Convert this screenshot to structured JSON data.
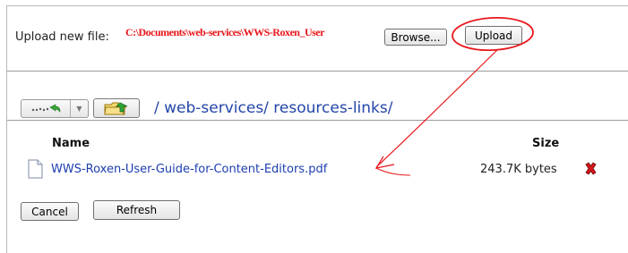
{
  "upload": {
    "label": "Upload new file:",
    "file_path_value": "C:\\Documents\\web-services\\WWS-Roxen_User",
    "browse_label": "Browse...",
    "upload_label": "Upload"
  },
  "navigation": {
    "back_icon": "back-history-icon",
    "dropdown_icon": "chevron-down-icon",
    "up_folder_icon": "folder-up-icon",
    "breadcrumb": "/ web-services/ resources-links/"
  },
  "file_table": {
    "columns": {
      "name": "Name",
      "size": "Size"
    },
    "rows": [
      {
        "name": "WWS-Roxen-User-Guide-for-Content-Editors.pdf",
        "size": "243.7K bytes",
        "icon": "document-icon",
        "delete_icon": "delete-x-icon"
      }
    ]
  },
  "actions": {
    "cancel_label": "Cancel",
    "refresh_label": "Refresh"
  },
  "colors": {
    "annotation_red": "#e8161b",
    "link_blue": "#1c3eb0",
    "breadcrumb_blue": "#2446a8"
  }
}
